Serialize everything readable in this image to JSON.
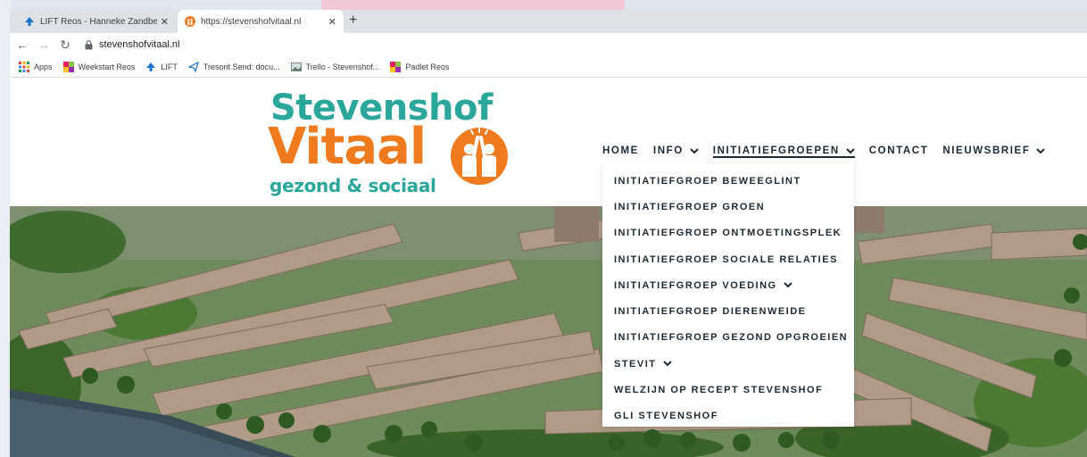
{
  "browser": {
    "tabs": [
      {
        "title": "LIFT Reos - Hanneke Zandbergen",
        "icon": "lift-favicon"
      },
      {
        "title": "https://stevenshofvitaal.nl",
        "icon": "stevenshof-favicon"
      }
    ],
    "new_tab_label": "+",
    "url": "stevenshofvitaal.nl",
    "bookmarks": [
      {
        "label": "Apps",
        "icon": "apps-grid-icon"
      },
      {
        "label": "Weekstart Reos",
        "icon": "colored-square-icon"
      },
      {
        "label": "LIFT",
        "icon": "lift-icon"
      },
      {
        "label": "Tresorit Send: docu...",
        "icon": "send-icon"
      },
      {
        "label": "Trello - Stevenshof...",
        "icon": "image-icon"
      },
      {
        "label": "Padlet Reos",
        "icon": "colored-square-icon"
      }
    ]
  },
  "site": {
    "logo": {
      "line1": "Stevenshof",
      "line2": "Vitaal",
      "line3": "gezond & sociaal"
    },
    "nav": [
      {
        "label": "HOME",
        "has_dropdown": false
      },
      {
        "label": "INFO",
        "has_dropdown": true
      },
      {
        "label": "INITIATIEFGROEPEN",
        "has_dropdown": true,
        "active": true
      },
      {
        "label": "CONTACT",
        "has_dropdown": false
      },
      {
        "label": "NIEUWSBRIEF",
        "has_dropdown": true
      }
    ],
    "dropdown": [
      {
        "label": "INITIATIEFGROEP BEWEEGLINT"
      },
      {
        "label": "INITIATIEFGROEP GROEN"
      },
      {
        "label": "INITIATIEFGROEP ONTMOETINGSPLEK"
      },
      {
        "label": "INITIATIEFGROEP SOCIALE RELATIES"
      },
      {
        "label": "INITIATIEFGROEP VOEDING",
        "has_submenu": true
      },
      {
        "label": "INITIATIEFGROEP DIERENWEIDE"
      },
      {
        "label": "INITIATIEFGROEP GEZOND OPGROEIEN"
      },
      {
        "label": "STEVIT",
        "has_submenu": true
      },
      {
        "label": "WELZIJN OP RECEPT STEVENSHOF"
      },
      {
        "label": "GLI STEVENSHOF"
      }
    ],
    "colors": {
      "teal": "#2aa69a",
      "orange": "#f07b1e",
      "nav_text": "#1d2a33"
    }
  }
}
